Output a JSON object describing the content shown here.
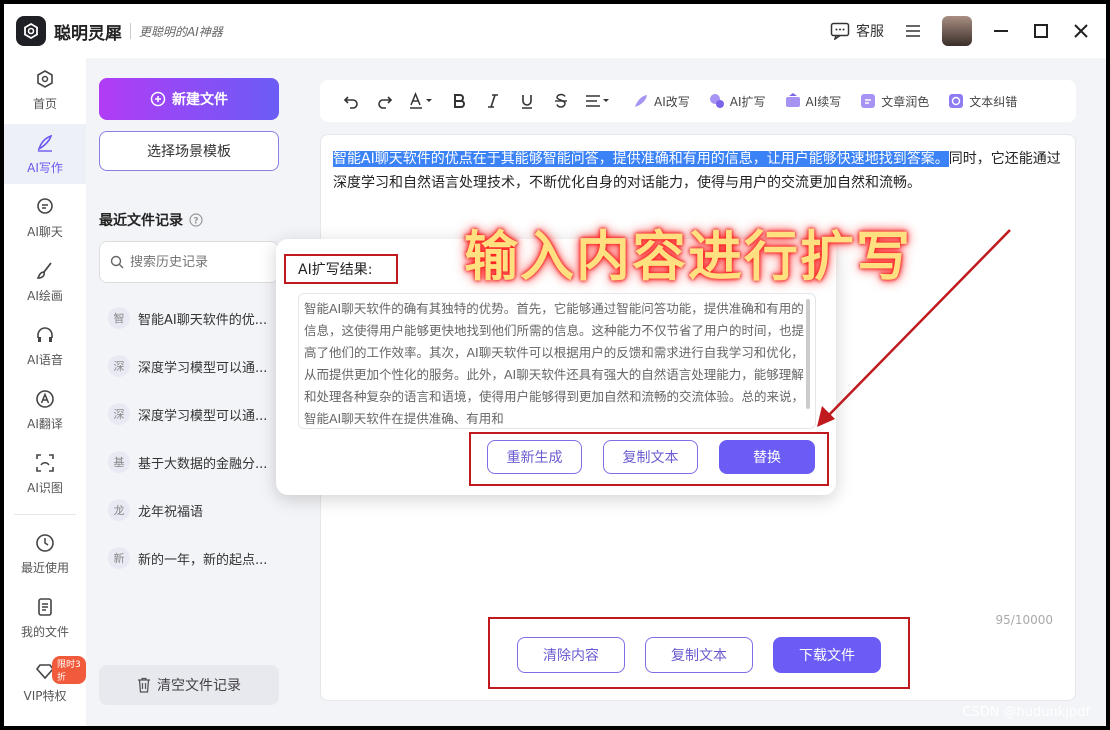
{
  "app": {
    "name": "聪明灵犀",
    "slogan": "更聪明的AI神器",
    "service_label": "客服"
  },
  "rail": {
    "items": [
      {
        "label": "首页"
      },
      {
        "label": "AI写作"
      },
      {
        "label": "AI聊天"
      },
      {
        "label": "AI绘画"
      },
      {
        "label": "AI语音"
      },
      {
        "label": "AI翻译"
      },
      {
        "label": "AI识图"
      },
      {
        "label": "最近使用"
      },
      {
        "label": "我的文件"
      },
      {
        "label": "VIP特权"
      }
    ],
    "vip_badge": "限时3折"
  },
  "sidebar": {
    "new_file": "新建文件",
    "choose_template": "选择场景模板",
    "recent_title": "最近文件记录",
    "search_placeholder": "搜索历史记录",
    "history": [
      {
        "tag": "智",
        "title": "智能AI聊天软件的优..."
      },
      {
        "tag": "深",
        "title": "深度学习模型可以通..."
      },
      {
        "tag": "深",
        "title": "深度学习模型可以通..."
      },
      {
        "tag": "基",
        "title": "基于大数据的金融分..."
      },
      {
        "tag": "龙",
        "title": "龙年祝福语"
      },
      {
        "tag": "新",
        "title": "新的一年，新的起点..."
      }
    ],
    "clear_records": "清空文件记录"
  },
  "toolbar": {
    "ai_tools": [
      {
        "label": "AI改写"
      },
      {
        "label": "AI扩写"
      },
      {
        "label": "AI续写"
      },
      {
        "label": "文章润色"
      },
      {
        "label": "文本纠错"
      }
    ]
  },
  "editor": {
    "selected_text": "智能AI聊天软件的优点在于其能够智能问答，提供准确和有用的信息，让用户能够快速地找到答案。",
    "rest_text": "同时，它还能通过深度学习和自然语言处理技术，不断优化自身的对话能力，使得与用户的交流更加自然和流畅。",
    "counter": "95/10000",
    "buttons": {
      "clear": "清除内容",
      "copy": "复制文本",
      "download": "下载文件"
    }
  },
  "popup": {
    "title": "AI扩写结果:",
    "result": "智能AI聊天软件的确有其独特的优势。首先，它能够通过智能问答功能，提供准确和有用的信息，这使得用户能够更快地找到他们所需的信息。这种能力不仅节省了用户的时间，也提高了他们的工作效率。其次，AI聊天软件可以根据用户的反馈和需求进行自我学习和优化，从而提供更加个性化的服务。此外，AI聊天软件还具有强大的自然语言处理能力，能够理解和处理各种复杂的语言和语境，使得用户能够得到更加自然和流畅的交流体验。总的来说，智能AI聊天软件在提供准确、有用和",
    "buttons": {
      "regenerate": "重新生成",
      "copy": "复制文本",
      "replace": "替换"
    }
  },
  "annotation": "输入内容进行扩写",
  "watermark": "CSDN @hudunkjpdf",
  "colors": {
    "accent": "#6a5cf5",
    "annotation_red": "#c0191e",
    "highlight": "#3b82f6"
  }
}
